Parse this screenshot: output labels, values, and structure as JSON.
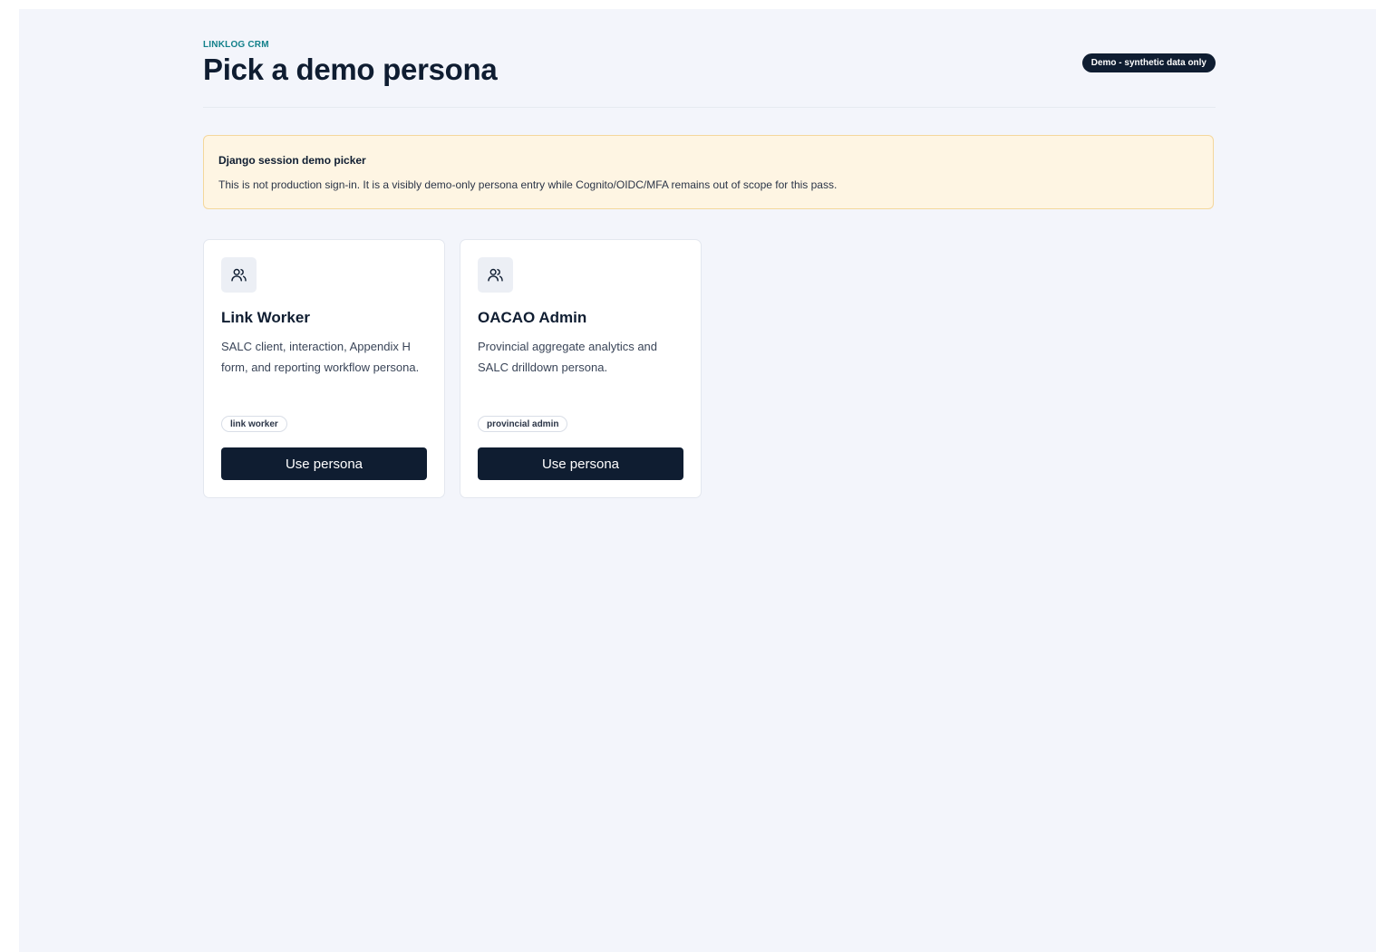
{
  "app": {
    "eyebrow": "LINKLOG CRM",
    "title": "Pick a demo persona",
    "badge": "Demo - synthetic data only"
  },
  "notice": {
    "title": "Django session demo picker",
    "body": "This is not production sign-in. It is a visibly demo-only persona entry while Cognito/OIDC/MFA remains out of scope for this pass."
  },
  "personas": [
    {
      "icon": "users-icon",
      "name": "Link Worker",
      "description": "SALC client, interaction, Appendix H form, and reporting workflow persona.",
      "tag": "link worker",
      "button_label": "Use persona"
    },
    {
      "icon": "users-icon",
      "name": "OACAO Admin",
      "description": "Provincial aggregate analytics and SALC drilldown persona.",
      "tag": "provincial admin",
      "button_label": "Use persona"
    }
  ],
  "colors": {
    "page_background": "#f3f5fb",
    "brand_navy": "#0f1d31",
    "eyebrow_teal": "#12808a",
    "notice_background": "#fef5e3",
    "notice_border": "#f4d79c"
  }
}
